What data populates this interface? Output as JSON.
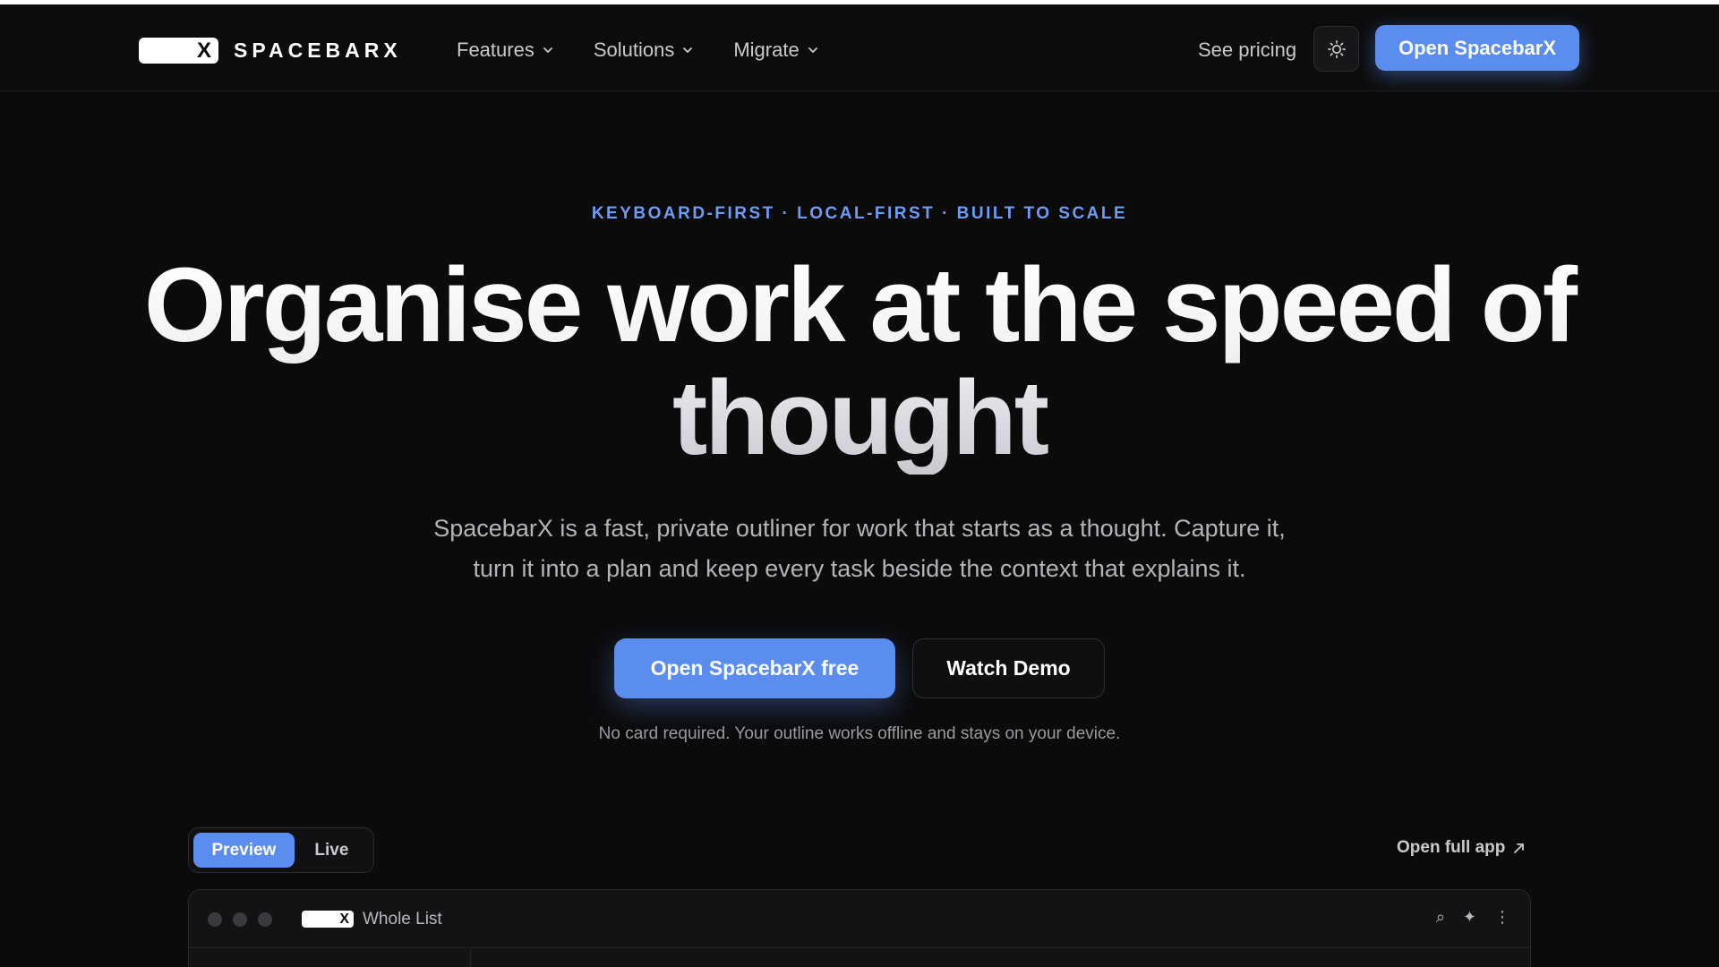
{
  "header": {
    "brand_name": "SPACEBARX",
    "logo_x": "X",
    "nav": [
      {
        "label": "Features"
      },
      {
        "label": "Solutions"
      },
      {
        "label": "Migrate"
      }
    ],
    "see_pricing": "See pricing",
    "theme_icon": "sun-icon",
    "open_button": "Open SpacebarX"
  },
  "hero": {
    "eyebrow": "KEYBOARD-FIRST · LOCAL-FIRST · BUILT TO SCALE",
    "headline_line1": "Organise work at the speed of",
    "headline_line2": "thought",
    "subtext": "SpacebarX is a fast, private outliner for work that starts as a thought. Capture it, turn it into a plan and keep every task beside the context that explains it.",
    "cta_primary": "Open SpacebarX free",
    "cta_secondary": "Watch Demo",
    "note": "No card required. Your outline works offline and stays on your device."
  },
  "preview": {
    "toggle": [
      {
        "label": "Preview",
        "active": true
      },
      {
        "label": "Live",
        "active": false
      }
    ],
    "open_full_app": "Open full app",
    "window_title": "Whole List",
    "window_icons": [
      "search-icon",
      "sparkle-icon",
      "more-vertical-icon"
    ]
  },
  "colors": {
    "background": "#0b0b0c",
    "accent": "#5b8def",
    "eyebrow": "#6e9bf3"
  }
}
